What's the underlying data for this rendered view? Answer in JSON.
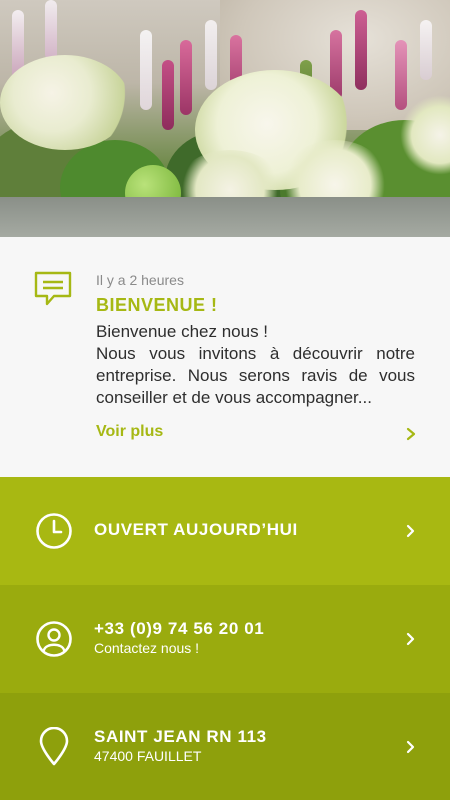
{
  "hero": {
    "image_name": "flower-arrangement-image"
  },
  "message": {
    "icon": "message-icon",
    "time": "Il y a 2 heures",
    "title": "BIENVENUE !",
    "line1": "Bienvenue chez nous !",
    "line2": "Nous vous invitons à découvrir notre entreprise. Nous serons ravis de vous conseiller et de vous accompagner...",
    "more_label": "Voir plus"
  },
  "hours": {
    "icon": "clock-icon",
    "title": "OUVERT AUJOURD’HUI"
  },
  "contact": {
    "icon": "user-icon",
    "phone": "+33 (0)9 74 56 20 01",
    "subtitle": "Contactez nous !"
  },
  "address": {
    "icon": "location-pin-icon",
    "street": "SAINT JEAN RN 113",
    "city": "47400 FAUILLET"
  },
  "colors": {
    "accent": "#a6b814",
    "row1": "#a8b812",
    "row2": "#9aab0e",
    "row3": "#8ea00c",
    "card_bg": "#f7f7f7"
  }
}
